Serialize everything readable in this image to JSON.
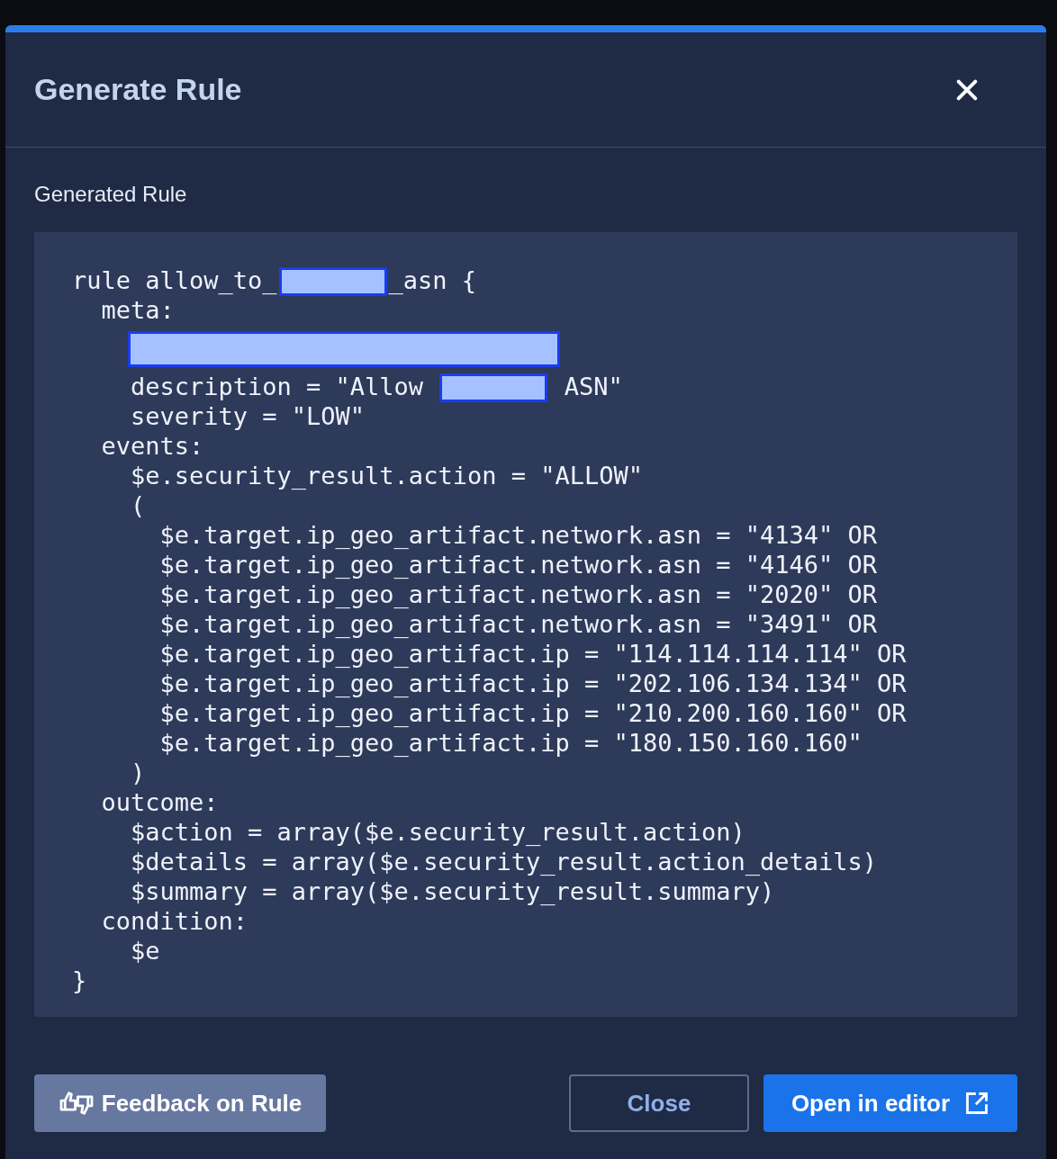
{
  "dialog": {
    "title": "Generate Rule",
    "section_label": "Generated Rule",
    "code_lines": [
      [
        {
          "kind": "text",
          "text": "rule allow_to_"
        },
        {
          "kind": "redacted"
        },
        {
          "kind": "text",
          "text": "_asn {"
        }
      ],
      [
        {
          "kind": "text",
          "text": "  meta:"
        }
      ],
      [
        {
          "kind": "redacted_wide"
        }
      ],
      [
        {
          "kind": "text",
          "text": "    description = \"Allow "
        },
        {
          "kind": "redacted"
        },
        {
          "kind": "text",
          "text": " ASN\""
        }
      ],
      [
        {
          "kind": "text",
          "text": "    severity = \"LOW\""
        }
      ],
      [
        {
          "kind": "text",
          "text": "  events:"
        }
      ],
      [
        {
          "kind": "text",
          "text": "    $e.security_result.action = \"ALLOW\""
        }
      ],
      [
        {
          "kind": "text",
          "text": "    ("
        }
      ],
      [
        {
          "kind": "text",
          "text": "      $e.target.ip_geo_artifact.network.asn = \"4134\" OR"
        }
      ],
      [
        {
          "kind": "text",
          "text": "      $e.target.ip_geo_artifact.network.asn = \"4146\" OR"
        }
      ],
      [
        {
          "kind": "text",
          "text": "      $e.target.ip_geo_artifact.network.asn = \"2020\" OR"
        }
      ],
      [
        {
          "kind": "text",
          "text": "      $e.target.ip_geo_artifact.network.asn = \"3491\" OR"
        }
      ],
      [
        {
          "kind": "text",
          "text": "      $e.target.ip_geo_artifact.ip = \"114.114.114.114\" OR"
        }
      ],
      [
        {
          "kind": "text",
          "text": "      $e.target.ip_geo_artifact.ip = \"202.106.134.134\" OR"
        }
      ],
      [
        {
          "kind": "text",
          "text": "      $e.target.ip_geo_artifact.ip = \"210.200.160.160\" OR"
        }
      ],
      [
        {
          "kind": "text",
          "text": "      $e.target.ip_geo_artifact.ip = \"180.150.160.160\""
        }
      ],
      [
        {
          "kind": "text",
          "text": "    )"
        }
      ],
      [
        {
          "kind": "text",
          "text": "  outcome:"
        }
      ],
      [
        {
          "kind": "text",
          "text": "    $action = array($e.security_result.action)"
        }
      ],
      [
        {
          "kind": "text",
          "text": "    $details = array($e.security_result.action_details)"
        }
      ],
      [
        {
          "kind": "text",
          "text": "    $summary = array($e.security_result.summary)"
        }
      ],
      [
        {
          "kind": "text",
          "text": "  condition:"
        }
      ],
      [
        {
          "kind": "text",
          "text": "    $e"
        }
      ],
      [
        {
          "kind": "text",
          "text": "}"
        }
      ]
    ],
    "buttons": {
      "feedback": "Feedback on Rule",
      "close": "Close",
      "open": "Open in editor"
    }
  }
}
